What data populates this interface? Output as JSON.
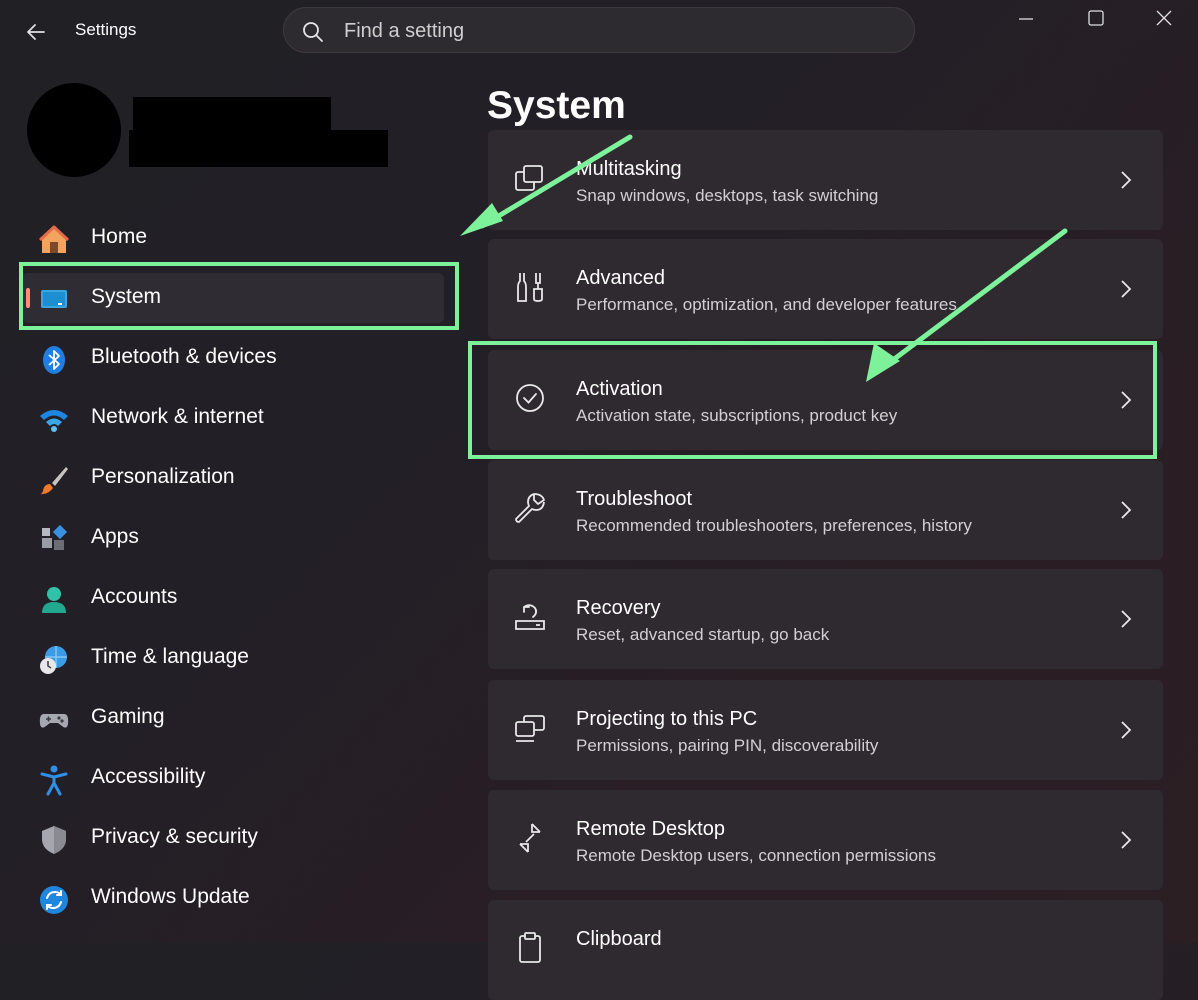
{
  "window": {
    "title": "Settings"
  },
  "search": {
    "placeholder": "Find a setting"
  },
  "nav": [
    {
      "label": "Home",
      "icon": "home-icon",
      "selected": false
    },
    {
      "label": "System",
      "icon": "system-monitor-icon",
      "selected": true
    },
    {
      "label": "Bluetooth & devices",
      "icon": "bluetooth-icon",
      "selected": false
    },
    {
      "label": "Network & internet",
      "icon": "wifi-icon",
      "selected": false
    },
    {
      "label": "Personalization",
      "icon": "paintbrush-icon",
      "selected": false
    },
    {
      "label": "Apps",
      "icon": "apps-icon",
      "selected": false
    },
    {
      "label": "Accounts",
      "icon": "accounts-icon",
      "selected": false
    },
    {
      "label": "Time & language",
      "icon": "globe-clock-icon",
      "selected": false
    },
    {
      "label": "Gaming",
      "icon": "gamepad-icon",
      "selected": false
    },
    {
      "label": "Accessibility",
      "icon": "accessibility-icon",
      "selected": false
    },
    {
      "label": "Privacy & security",
      "icon": "shield-icon",
      "selected": false
    },
    {
      "label": "Windows Update",
      "icon": "update-icon",
      "selected": false
    }
  ],
  "main": {
    "title": "System",
    "cards": [
      {
        "title": "Multitasking",
        "subtitle": "Snap windows, desktops, task switching",
        "icon": "multitasking-icon"
      },
      {
        "title": "Advanced",
        "subtitle": "Performance, optimization, and developer features",
        "icon": "advanced-tools-icon"
      },
      {
        "title": "Activation",
        "subtitle": "Activation state, subscriptions, product key",
        "icon": "activation-check-icon"
      },
      {
        "title": "Troubleshoot",
        "subtitle": "Recommended troubleshooters, preferences, history",
        "icon": "wrench-icon"
      },
      {
        "title": "Recovery",
        "subtitle": "Reset, advanced startup, go back",
        "icon": "recovery-icon"
      },
      {
        "title": "Projecting to this PC",
        "subtitle": "Permissions, pairing PIN, discoverability",
        "icon": "projecting-icon"
      },
      {
        "title": "Remote Desktop",
        "subtitle": "Remote Desktop users, connection permissions",
        "icon": "remote-desktop-icon"
      },
      {
        "title": "Clipboard",
        "subtitle": "",
        "icon": "clipboard-icon"
      }
    ]
  },
  "colors": {
    "highlight": "#7ef29a",
    "selection_bar": "#ff8a7a",
    "card_bg": "#2f2a2f"
  }
}
